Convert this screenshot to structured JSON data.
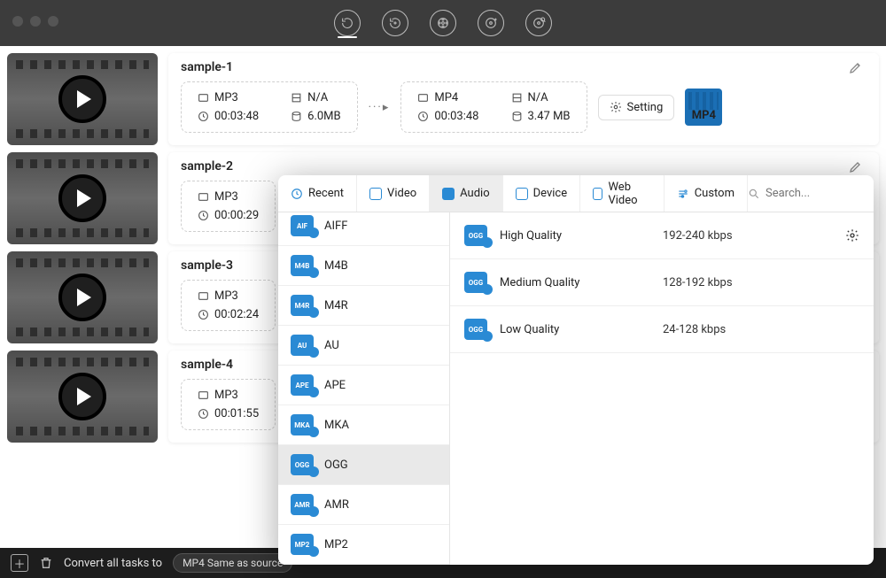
{
  "header": {
    "tool_icons": [
      "refresh",
      "refresh-dot",
      "film",
      "film-plus",
      "film-search"
    ]
  },
  "rows": [
    {
      "title": "sample-1",
      "src": {
        "fmt": "MP3",
        "dur": "00:03:48",
        "bit": "N/A",
        "size": "6.0MB"
      },
      "dst": {
        "fmt": "MP4",
        "dur": "00:03:48",
        "bit": "N/A",
        "size": "3.47 MB"
      },
      "setting_label": "Setting",
      "fmt_badge": "MP4"
    },
    {
      "title": "sample-2",
      "src": {
        "fmt": "MP3",
        "dur": "00:00:29"
      }
    },
    {
      "title": "sample-3",
      "src": {
        "fmt": "MP3",
        "dur": "00:02:24"
      }
    },
    {
      "title": "sample-4",
      "src": {
        "fmt": "MP3",
        "dur": "00:01:55"
      }
    }
  ],
  "footer": {
    "label": "Convert all tasks to",
    "preset": "MP4 Same as source"
  },
  "popover": {
    "tabs": [
      "Recent",
      "Video",
      "Audio",
      "Device",
      "Web Video",
      "Custom"
    ],
    "active_tab": 2,
    "search_placeholder": "Search...",
    "formats": [
      "AIFF",
      "M4B",
      "M4R",
      "AU",
      "APE",
      "MKA",
      "OGG",
      "AMR",
      "MP2"
    ],
    "selected_format": "OGG",
    "qualities": [
      {
        "name": "High Quality",
        "bitrate": "192-240 kbps",
        "gear": true
      },
      {
        "name": "Medium Quality",
        "bitrate": "128-192 kbps"
      },
      {
        "name": "Low Quality",
        "bitrate": "24-128 kbps"
      }
    ]
  }
}
